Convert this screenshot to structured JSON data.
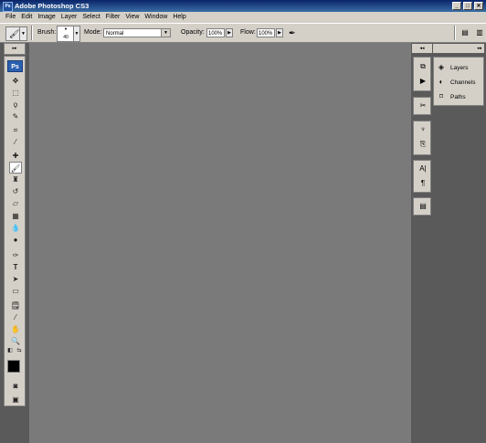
{
  "window": {
    "title": "Adobe Photoshop CS3",
    "app_icon": "Ps",
    "minimize": "_",
    "maximize": "□",
    "close": "✕"
  },
  "menu": [
    "File",
    "Edit",
    "Image",
    "Layer",
    "Select",
    "Filter",
    "View",
    "Window",
    "Help"
  ],
  "options": {
    "brush_label": "Brush:",
    "brush_size": "40",
    "mode_label": "Mode:",
    "mode_value": "Normal",
    "opacity_label": "Opacity:",
    "opacity_value": "100%",
    "flow_label": "Flow:",
    "flow_value": "100%"
  },
  "toolbox": {
    "logo": "Ps",
    "tools": [
      "move-icon",
      "marquee-icon",
      "lasso-icon",
      "quick-select-icon",
      "crop-icon",
      "slice-icon",
      "healing-brush-icon",
      "brush-icon",
      "clone-stamp-icon",
      "history-brush-icon",
      "eraser-icon",
      "gradient-icon",
      "blur-icon",
      "dodge-icon",
      "pen-icon",
      "type-icon",
      "path-select-icon",
      "shape-icon",
      "notes-icon",
      "eyedropper-icon",
      "hand-icon",
      "zoom-icon"
    ],
    "active_tool": "brush-icon"
  },
  "panels": {
    "layers": "Layers",
    "channels": "Channels",
    "paths": "Paths"
  },
  "colors": {
    "foreground": "#000000",
    "background": "#ffffff",
    "canvas": "#7a7a7a",
    "title_bar": "#0b246a"
  }
}
